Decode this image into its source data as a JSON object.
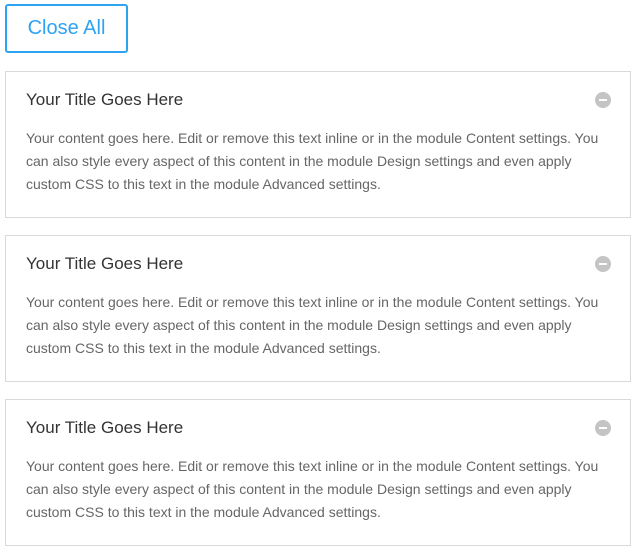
{
  "toolbar": {
    "close_all_label": "Close All"
  },
  "colors": {
    "accent": "#2ea3f2",
    "border": "#d9d9d9",
    "title_text": "#333333",
    "body_text": "#666666",
    "icon": "#c4c4c4"
  },
  "toggles": [
    {
      "title": "Your Title Goes Here",
      "state": "open",
      "icon": "minus-circle-icon",
      "content": "Your content goes here. Edit or remove this text inline or in the module Content settings. You can also style every aspect of this content in the module Design settings and even apply custom CSS to this text in the module Advanced settings."
    },
    {
      "title": "Your Title Goes Here",
      "state": "open",
      "icon": "minus-circle-icon",
      "content": "Your content goes here. Edit or remove this text inline or in the module Content settings. You can also style every aspect of this content in the module Design settings and even apply custom CSS to this text in the module Advanced settings."
    },
    {
      "title": "Your Title Goes Here",
      "state": "open",
      "icon": "minus-circle-icon",
      "content": "Your content goes here. Edit or remove this text inline or in the module Content settings. You can also style every aspect of this content in the module Design settings and even apply custom CSS to this text in the module Advanced settings."
    }
  ]
}
